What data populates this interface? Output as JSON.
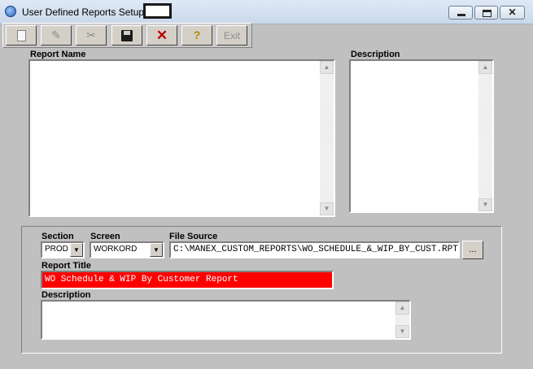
{
  "window": {
    "title": "User Defined Reports Setup",
    "minimize_label": "",
    "maximize_label": "",
    "close_label": "✕"
  },
  "toolbar": {
    "new_icon": "new-document-icon",
    "edit_icon": "edit-icon",
    "cut_icon": "scissors-icon",
    "save_icon": "floppy-disk-icon",
    "delete_icon": "red-x-icon",
    "help_icon": "question-mark-icon",
    "cut_glyph": "✂",
    "edit_glyph": "✎",
    "delete_glyph": "✕",
    "help_glyph": "?",
    "exit_label": "Exit"
  },
  "report_list": {
    "label": "Report Name",
    "items": []
  },
  "description_list": {
    "label": "Description",
    "items": []
  },
  "details": {
    "section_label": "Section",
    "section_value": "PROD",
    "screen_label": "Screen",
    "screen_value": "WORKORD",
    "file_source_label": "File Source",
    "file_source_value": "C:\\MANEX_CUSTOM_REPORTS\\WO_SCHEDULE_&_WIP_BY_CUST.RPT",
    "browse_label": "...",
    "report_title_label": "Report Title",
    "report_title_value": "WO Schedule & WIP By Customer Report",
    "description_label": "Description",
    "description_value": ""
  },
  "scroll": {
    "up_glyph": "▲",
    "down_glyph": "▼",
    "dropdown_glyph": "▼"
  },
  "colors": {
    "window_bg": "#c0c0c0",
    "title_field_bg": "#ff0000",
    "title_field_text": "#ffffff"
  }
}
